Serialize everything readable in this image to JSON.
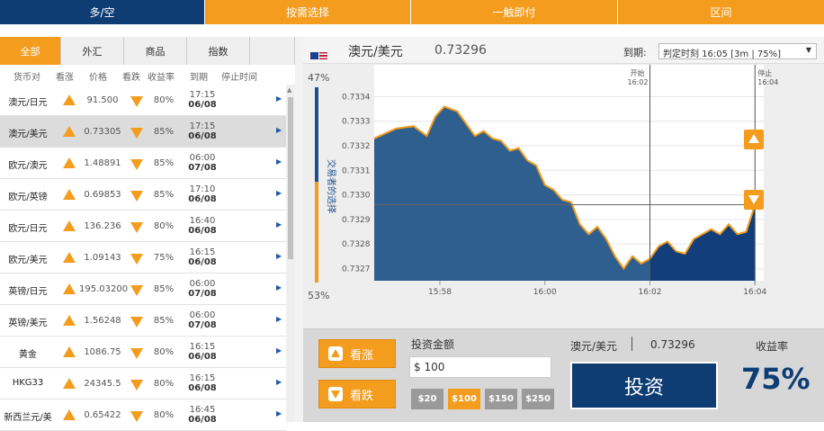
{
  "nav": [
    "多/空",
    "按需选择",
    "一触即付",
    "区间"
  ],
  "categories": [
    "全部",
    "外汇",
    "商品",
    "指数"
  ],
  "columns": {
    "pair": "货币对",
    "up": "看涨",
    "price": "价格",
    "down": "看跌",
    "yield": "收益率",
    "expiry": "到期",
    "stop": "停止时间"
  },
  "assets": [
    {
      "pair": "澳元/日元",
      "price": "91.500",
      "yield": "80%",
      "time": "17:15",
      "date": "06/08"
    },
    {
      "pair": "澳元/美元",
      "price": "0.73305",
      "yield": "85%",
      "time": "17:15",
      "date": "06/08"
    },
    {
      "pair": "欧元/澳元",
      "price": "1.48891",
      "yield": "85%",
      "time": "06:00",
      "date": "07/08"
    },
    {
      "pair": "欧元/英镑",
      "price": "0.69853",
      "yield": "85%",
      "time": "17:10",
      "date": "06/08"
    },
    {
      "pair": "欧元/日元",
      "price": "136.236",
      "yield": "80%",
      "time": "16:40",
      "date": "06/08"
    },
    {
      "pair": "欧元/美元",
      "price": "1.09143",
      "yield": "75%",
      "time": "16:15",
      "date": "06/08"
    },
    {
      "pair": "英镑/日元",
      "price": "195.03200",
      "yield": "85%",
      "time": "06:00",
      "date": "07/08"
    },
    {
      "pair": "英镑/美元",
      "price": "1.56248",
      "yield": "85%",
      "time": "06:00",
      "date": "07/08"
    },
    {
      "pair": "黄金",
      "price": "1086.75",
      "yield": "80%",
      "time": "16:15",
      "date": "06/08"
    },
    {
      "pair": "HKG33",
      "price": "24345.5",
      "yield": "80%",
      "time": "16:15",
      "date": "06/08"
    },
    {
      "pair": "新西兰元/美",
      "price": "0.65422",
      "yield": "80%",
      "time": "16:45",
      "date": "06/08"
    }
  ],
  "chart": {
    "pair": "澳元/美元",
    "price": "0.73296",
    "expiry_label": "到期:",
    "expiry_value": "判定时刻 16:05 [3m | 75%]",
    "sentiment_top": "47%",
    "sentiment_bottom": "53%",
    "sentiment_label": "交易者的选择",
    "start_label": "开始",
    "start_time": "16:02",
    "stop_label": "停止",
    "stop_time": "16:04"
  },
  "chart_data": {
    "type": "area",
    "y_ticks": [
      "0.7334",
      "0.7333",
      "0.7332",
      "0.7331",
      "0.7330",
      "0.7329",
      "0.7328",
      "0.7327"
    ],
    "x_ticks": [
      "15:58",
      "16:00",
      "16:02",
      "16:04"
    ],
    "ylim": [
      0.73265,
      0.73342
    ],
    "xlim": [
      "15:56:45",
      "16:04:10"
    ],
    "current_value": 0.73296,
    "series": [
      {
        "x": [
          "15:56:45",
          "15:57:10",
          "15:57:30",
          "15:57:45",
          "15:57:55",
          "15:58:05",
          "15:58:20",
          "15:58:30",
          "15:58:40",
          "15:58:50",
          "15:59:00",
          "15:59:10",
          "15:59:20",
          "15:59:30",
          "15:59:40",
          "15:59:50",
          "16:00:00",
          "16:00:10",
          "16:00:20",
          "16:00:30",
          "16:00:40",
          "16:00:50",
          "16:01:00",
          "16:01:10",
          "16:01:20",
          "16:01:30",
          "16:01:40",
          "16:01:50",
          "16:02:00",
          "16:02:10",
          "16:02:20",
          "16:02:30",
          "16:02:40",
          "16:02:50",
          "16:03:00",
          "16:03:10",
          "16:03:20",
          "16:03:30",
          "16:03:40",
          "16:03:50",
          "16:04:00"
        ],
        "y": [
          0.73323,
          0.73327,
          0.73328,
          0.73324,
          0.73332,
          0.73336,
          0.73334,
          0.73329,
          0.73324,
          0.73326,
          0.73323,
          0.73322,
          0.73318,
          0.73319,
          0.73314,
          0.73312,
          0.73304,
          0.73302,
          0.73298,
          0.73297,
          0.73288,
          0.73284,
          0.73287,
          0.73282,
          0.73275,
          0.7327,
          0.73275,
          0.73272,
          0.73274,
          0.73279,
          0.73281,
          0.73277,
          0.73276,
          0.73282,
          0.73284,
          0.73286,
          0.73284,
          0.73288,
          0.73284,
          0.73285,
          0.73296
        ]
      }
    ]
  },
  "trade": {
    "up_label": "看涨",
    "down_label": "看跌",
    "amount_label": "投资金额",
    "amount_value": "$ 100",
    "amounts": [
      "$20",
      "$100",
      "$150",
      "$250"
    ],
    "selected_amount": "$100",
    "invest_label": "投资",
    "yield_label": "收益率",
    "yield_value": "75%"
  },
  "colors": {
    "brand_blue": "#0e3d74",
    "accent_orange": "#f39c1e",
    "area_fill": "#2f5f8f",
    "area_fill_after": "#123f7c"
  }
}
